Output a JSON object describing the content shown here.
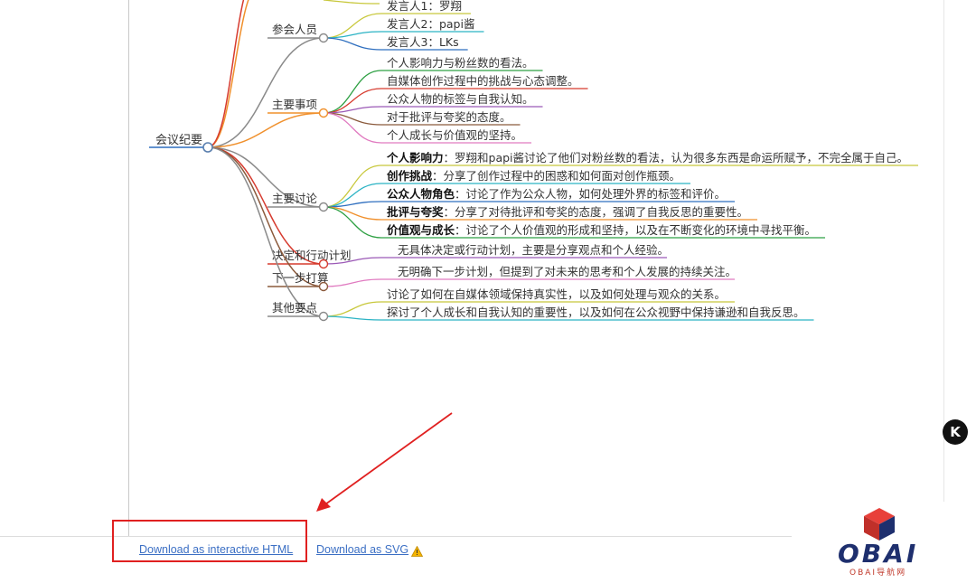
{
  "mindmap": {
    "root": "会议纪要",
    "branches": [
      {
        "id": "attendees",
        "label": "参会人员",
        "color": "#8a8a8a",
        "items": [
          {
            "text": "发言人1：罗翔",
            "color": "#c8c83c"
          },
          {
            "text": "发言人2：papi酱",
            "color": "#2bb3c4"
          },
          {
            "text": "发言人3：LKs",
            "color": "#2f6fbf"
          }
        ]
      },
      {
        "id": "matters",
        "label": "主要事项",
        "color": "#f0902c",
        "items": [
          {
            "text": "个人影响力与粉丝数的看法。",
            "color": "#2ea043"
          },
          {
            "text": "自媒体创作过程中的挑战与心态调整。",
            "color": "#d63b2f"
          },
          {
            "text": "公众人物的标签与自我认知。",
            "color": "#9b59b6"
          },
          {
            "text": "对于批评与夸奖的态度。",
            "color": "#8b5a3c"
          },
          {
            "text": "个人成长与价值观的坚持。",
            "color": "#e07ac0"
          }
        ]
      },
      {
        "id": "discussion",
        "label": "主要讨论",
        "color": "#8a8a8a",
        "items": [
          {
            "title": "个人影响力",
            "text": "：罗翔和papi酱讨论了他们对粉丝数的看法，认为很多东西是命运所赋予，不完全属于自己。",
            "color": "#c8c83c"
          },
          {
            "title": "创作挑战",
            "text": "：分享了创作过程中的困惑和如何面对创作瓶颈。",
            "color": "#2bb3c4"
          },
          {
            "title": "公众人物角色",
            "text": "：讨论了作为公众人物，如何处理外界的标签和评价。",
            "color": "#2f6fbf"
          },
          {
            "title": "批评与夸奖",
            "text": "：分享了对待批评和夸奖的态度，强调了自我反思的重要性。",
            "color": "#f0902c"
          },
          {
            "title": "价值观与成长",
            "text": "：讨论了个人价值观的形成和坚持，以及在不断变化的环境中寻找平衡。",
            "color": "#2ea043"
          }
        ]
      },
      {
        "id": "decisions",
        "label": "决定和行动计划",
        "color": "#d63b2f",
        "items": [
          {
            "text": "无具体决定或行动计划，主要是分享观点和个人经验。",
            "color": "#9b59b6"
          }
        ]
      },
      {
        "id": "next",
        "label": "下一步打算",
        "color": "#8b5a3c",
        "items": [
          {
            "text": "无明确下一步计划，但提到了对未来的思考和个人发展的持续关注。",
            "color": "#e07ac0"
          }
        ]
      },
      {
        "id": "others",
        "label": "其他要点",
        "color": "#8a8a8a",
        "items": [
          {
            "text": "讨论了如何在自媒体领域保持真实性，以及如何处理与观众的关系。",
            "color": "#c8c83c"
          },
          {
            "text": "探讨了个人成长和自我认知的重要性，以及如何在公众视野中保持谦逊和自我反思。",
            "color": "#2bb3c4"
          }
        ]
      }
    ]
  },
  "footer": {
    "download_html": "Download as interactive HTML",
    "download_svg": "Download as SVG"
  },
  "badge": {
    "letter": "K"
  },
  "watermark": {
    "main": "OBAI",
    "sub": "OBAI导航网"
  },
  "colors": {
    "highlight": "#e02020",
    "link": "#3b6fc4",
    "root_line": "#2f6fbf"
  },
  "icons": {
    "warning": "warning-icon",
    "logo": "cube-logo-icon"
  }
}
